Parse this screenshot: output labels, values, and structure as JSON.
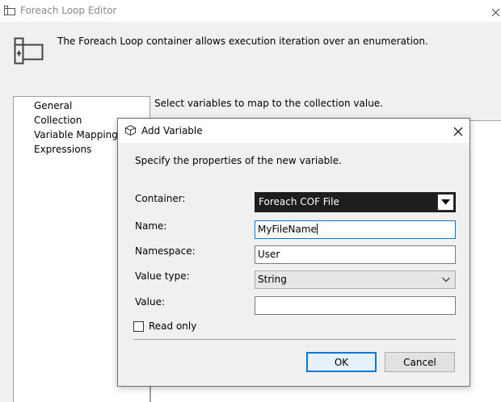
{
  "parent_window": {
    "title": "Foreach Loop Editor",
    "header_description": "The Foreach Loop container allows execution iteration over an enumeration.",
    "nav_items": [
      "General",
      "Collection",
      "Variable Mappings",
      "Expressions"
    ],
    "panel_instruction": "Select variables to map to the collection value."
  },
  "dialog": {
    "title": "Add Variable",
    "description": "Specify the properties of the new variable.",
    "container": {
      "label": "Container:",
      "value": "Foreach COF File"
    },
    "name": {
      "label": "Name:",
      "value": "MyFileName"
    },
    "namespace": {
      "label": "Namespace:",
      "value": "User"
    },
    "value_type": {
      "label": "Value type:",
      "value": "String"
    },
    "value": {
      "label": "Value:",
      "value": ""
    },
    "read_only": {
      "label": "Read only",
      "checked": false
    },
    "ok_label": "OK",
    "cancel_label": "Cancel"
  },
  "icons": {
    "parent_title": "foreach-loop-icon",
    "header": "foreach-container-icon",
    "dialog_title": "variable-icon",
    "dialog_close": "close-icon",
    "container_dropdown": "dropdown-arrow-icon",
    "value_type_dropdown": "chevron-down-icon"
  },
  "colors": {
    "focus_accent": "#0078d7",
    "container_select_bg": "#1e1e1e"
  }
}
